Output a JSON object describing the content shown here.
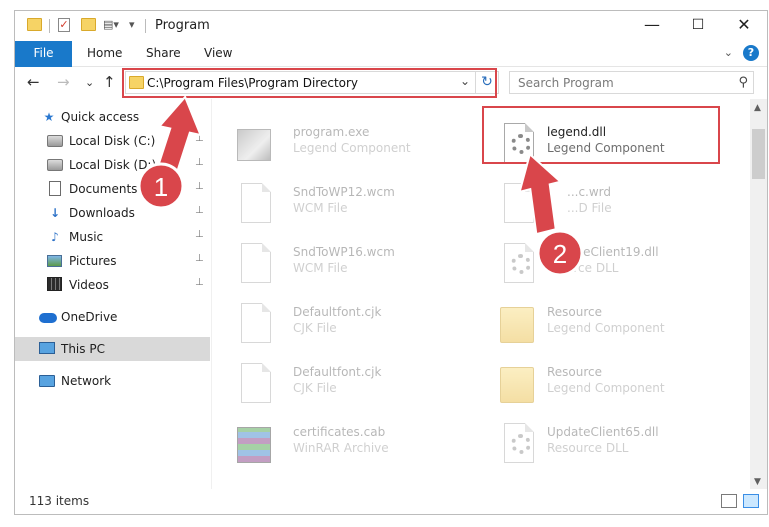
{
  "window": {
    "title": "Program",
    "controls": {
      "minimize": "—",
      "maximize": "☐",
      "close": "✕"
    }
  },
  "ribbon": {
    "tabs": [
      "File",
      "Home",
      "Share",
      "View"
    ],
    "expand": "⌄",
    "help": "?"
  },
  "navigation": {
    "back": "←",
    "forward": "→",
    "recent": "⌄",
    "up": "↑",
    "address": "C:\\Program Files\\Program Directory",
    "address_dropdown": "⌄",
    "refresh": "↻",
    "search_placeholder": "Search Program",
    "search_icon": "⚲"
  },
  "sidebar": {
    "items": [
      {
        "label": "Quick access",
        "icon": "star-icon",
        "pinned": false
      },
      {
        "label": "Local Disk (C:)",
        "icon": "drive-icon",
        "pinned": true
      },
      {
        "label": "Local Disk (D:)",
        "icon": "drive-icon",
        "pinned": true
      },
      {
        "label": "Documents",
        "icon": "documents-icon",
        "pinned": true
      },
      {
        "label": "Downloads",
        "icon": "downloads-icon",
        "pinned": true
      },
      {
        "label": "Music",
        "icon": "music-icon",
        "pinned": true
      },
      {
        "label": "Pictures",
        "icon": "pictures-icon",
        "pinned": true
      },
      {
        "label": "Videos",
        "icon": "videos-icon",
        "pinned": true
      },
      {
        "label": "OneDrive",
        "icon": "onedrive-icon",
        "pinned": false
      },
      {
        "label": "This PC",
        "icon": "this-pc-icon",
        "pinned": false,
        "selected": true
      },
      {
        "label": "Network",
        "icon": "network-icon",
        "pinned": false
      }
    ],
    "pin_glyph": "📌"
  },
  "files": [
    {
      "name": "program.exe",
      "type": "Legend Component",
      "icon": "setup-icon",
      "faded": true
    },
    {
      "name": "legend.dll",
      "type": "Legend Component",
      "icon": "dll-gear-icon",
      "faded": false,
      "highlighted": true
    },
    {
      "name": "SndToWP12.wcm",
      "type": "WCM File",
      "icon": "generic-file-icon",
      "faded": true
    },
    {
      "name": "...c.wrd",
      "type": "...D File",
      "icon": "generic-file-icon",
      "faded": true
    },
    {
      "name": "SndToWP16.wcm",
      "type": "WCM File",
      "icon": "generic-file-icon",
      "faded": true
    },
    {
      "name": "UpdateClient19.dll",
      "type": "...ource DLL",
      "icon": "dll-gear-icon",
      "faded": true
    },
    {
      "name": "Defaultfont.cjk",
      "type": "CJK File",
      "icon": "generic-file-icon",
      "faded": true
    },
    {
      "name": "Resource",
      "type": "Legend Component",
      "icon": "folder-icon",
      "faded": true
    },
    {
      "name": "Defaultfont.cjk",
      "type": "CJK File",
      "icon": "generic-file-icon",
      "faded": true
    },
    {
      "name": "Resource",
      "type": "Legend Component",
      "icon": "folder-icon",
      "faded": true
    },
    {
      "name": "certificates.cab",
      "type": "WinRAR Archive",
      "icon": "winrar-icon",
      "faded": true
    },
    {
      "name": "UpdateClient65.dll",
      "type": "Resource DLL",
      "icon": "dll-gear-icon",
      "faded": true
    }
  ],
  "status": {
    "item_count": "113 items"
  },
  "annotations": {
    "step1": "1",
    "step2": "2",
    "color": "#d9464b"
  }
}
